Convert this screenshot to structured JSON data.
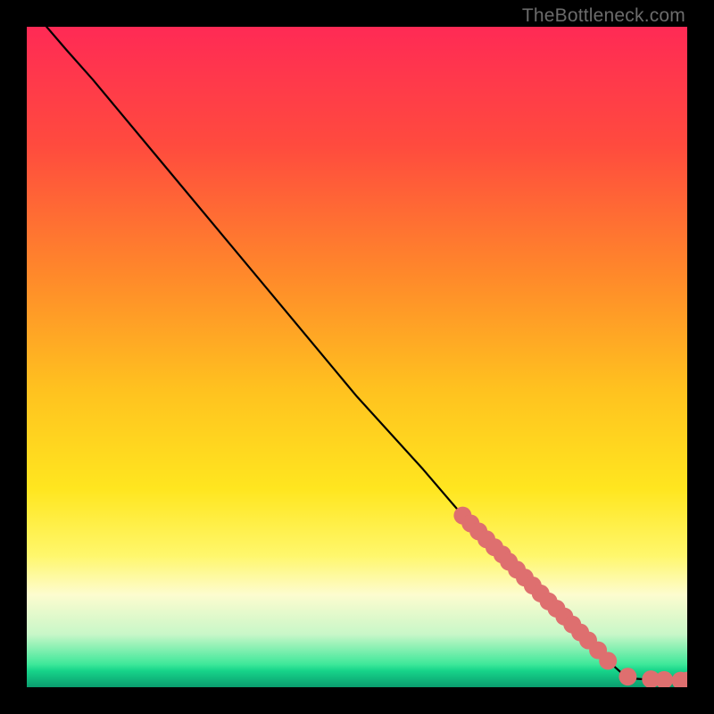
{
  "attribution": "TheBottleneck.com",
  "chart_data": {
    "type": "line",
    "title": "",
    "xlabel": "",
    "ylabel": "",
    "xlim": [
      0,
      100
    ],
    "ylim": [
      0,
      100
    ],
    "gradient_stops": [
      {
        "offset": 0,
        "color": "#ff2a55"
      },
      {
        "offset": 18,
        "color": "#ff4b3e"
      },
      {
        "offset": 38,
        "color": "#ff8a2a"
      },
      {
        "offset": 55,
        "color": "#ffc21f"
      },
      {
        "offset": 70,
        "color": "#ffe61f"
      },
      {
        "offset": 80,
        "color": "#fff76b"
      },
      {
        "offset": 86,
        "color": "#fdfccf"
      },
      {
        "offset": 92,
        "color": "#c8f7c8"
      },
      {
        "offset": 96.5,
        "color": "#3fe89a"
      },
      {
        "offset": 97.5,
        "color": "#17d48a"
      },
      {
        "offset": 100,
        "color": "#0a9c6e"
      }
    ],
    "curve": [
      {
        "x": 3,
        "y": 100
      },
      {
        "x": 6,
        "y": 96.5
      },
      {
        "x": 10,
        "y": 92
      },
      {
        "x": 20,
        "y": 80
      },
      {
        "x": 30,
        "y": 68
      },
      {
        "x": 40,
        "y": 56
      },
      {
        "x": 50,
        "y": 44
      },
      {
        "x": 60,
        "y": 33
      },
      {
        "x": 66,
        "y": 26
      },
      {
        "x": 70,
        "y": 22
      },
      {
        "x": 75,
        "y": 17
      },
      {
        "x": 80,
        "y": 12
      },
      {
        "x": 84,
        "y": 8
      },
      {
        "x": 88,
        "y": 4
      },
      {
        "x": 90,
        "y": 2.2
      },
      {
        "x": 92,
        "y": 1.3
      },
      {
        "x": 95,
        "y": 1.1
      },
      {
        "x": 98,
        "y": 1.0
      },
      {
        "x": 100,
        "y": 1.0
      }
    ],
    "markers": [
      {
        "x": 66,
        "y": 26.0
      },
      {
        "x": 67.2,
        "y": 24.8
      },
      {
        "x": 68.4,
        "y": 23.6
      },
      {
        "x": 69.6,
        "y": 22.4
      },
      {
        "x": 70.8,
        "y": 21.2
      },
      {
        "x": 72.0,
        "y": 20.1
      },
      {
        "x": 73.0,
        "y": 19.0
      },
      {
        "x": 74.2,
        "y": 17.8
      },
      {
        "x": 75.4,
        "y": 16.6
      },
      {
        "x": 76.6,
        "y": 15.4
      },
      {
        "x": 77.8,
        "y": 14.2
      },
      {
        "x": 79.0,
        "y": 13.0
      },
      {
        "x": 80.2,
        "y": 11.9
      },
      {
        "x": 81.4,
        "y": 10.7
      },
      {
        "x": 82.6,
        "y": 9.5
      },
      {
        "x": 83.8,
        "y": 8.3
      },
      {
        "x": 85.0,
        "y": 7.1
      },
      {
        "x": 86.5,
        "y": 5.6
      },
      {
        "x": 88.0,
        "y": 4.0
      },
      {
        "x": 91.0,
        "y": 1.6
      },
      {
        "x": 94.5,
        "y": 1.2
      },
      {
        "x": 96.5,
        "y": 1.1
      },
      {
        "x": 99.0,
        "y": 1.0
      },
      {
        "x": 100.0,
        "y": 1.0
      }
    ],
    "marker_color": "#de6f6f",
    "marker_radius_pct": 1.35,
    "line_color": "#000000"
  }
}
